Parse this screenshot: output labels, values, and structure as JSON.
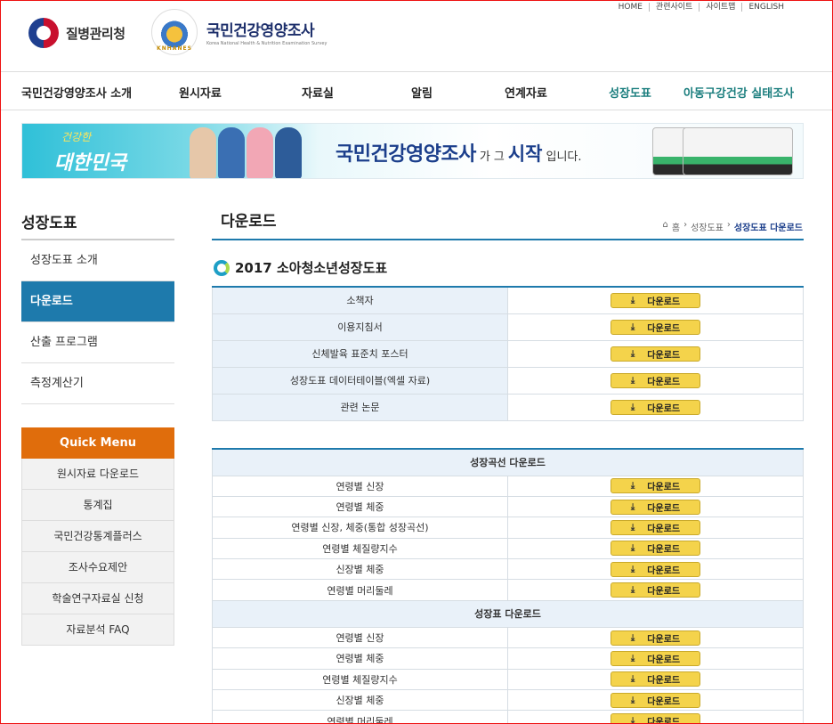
{
  "util_links": [
    "HOME",
    "관련사이트",
    "사이트맵",
    "ENGLISH"
  ],
  "logos": {
    "kdca": "질병관리청",
    "knhanes_title": "국민건강영양조사",
    "knhanes_sub": "Korea National Health & Nutrition Examination Survey",
    "knhanes_seal": "KNHANES"
  },
  "gnb": [
    "국민건강영양조사 소개",
    "원시자료",
    "자료실",
    "알림",
    "연계자료",
    "성장도표",
    "아동구강건강 실태조사"
  ],
  "banner": {
    "slogan1": "건강한",
    "slogan2": "대한민국",
    "msg_big": "국민건강영양조사",
    "msg_ga": "가",
    "msg_geu": "그",
    "msg_start": "시작",
    "msg_end": "입니다."
  },
  "lnb": {
    "title": "성장도표",
    "items": [
      "성장도표 소개",
      "다운로드",
      "산출 프로그램",
      "측정계산기"
    ]
  },
  "quick_menu": {
    "title": "Quick Menu",
    "items": [
      "원시자료 다운로드",
      "통계집",
      "국민건강통계플러스",
      "조사수요제안",
      "학술연구자료실 신청",
      "자료분석 FAQ"
    ]
  },
  "content": {
    "title": "다운로드",
    "breadcrumb": [
      "홈",
      "성장도표",
      "성장도표 다운로드"
    ],
    "section_title": "2017 소아청소년성장도표",
    "download_label": "다운로드",
    "docs": [
      "소책자",
      "이용지침서",
      "신체발육 표준치 포스터",
      "성장도표 데이터테이블(엑셀 자료)",
      "관련 논문"
    ],
    "curve_group": "성장곡선 다운로드",
    "curves": [
      "연령별 신장",
      "연령별 체중",
      "연령별 신장, 체중(통합 성장곡선)",
      "연령별 체질량지수",
      "신장별 체중",
      "연령별 머리둘레"
    ],
    "table_group": "성장표 다운로드",
    "tables": [
      "연령별 신장",
      "연령별 체중",
      "연령별 체질량지수",
      "신장별 체중",
      "연령별 머리둘레"
    ]
  }
}
